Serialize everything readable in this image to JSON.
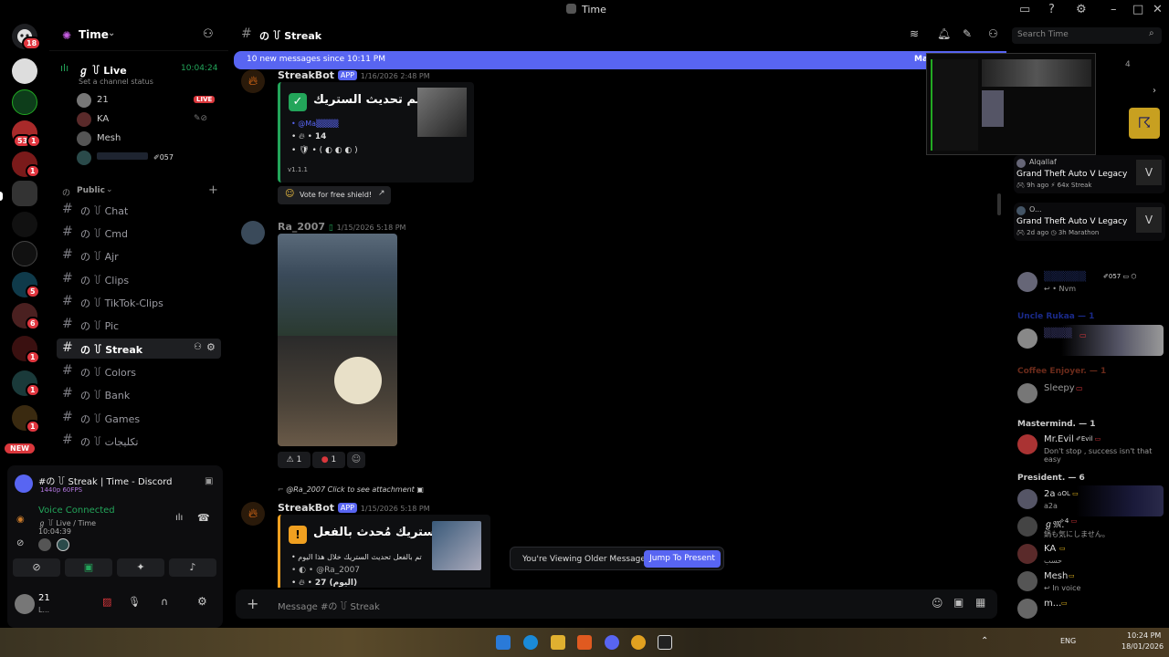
{
  "window": {
    "title": "Time"
  },
  "colors": {
    "accent": "#5865f2",
    "live": "#da373c",
    "voice_green": "#23a55a",
    "bg": "#000000",
    "new_badge": "#da373c"
  },
  "guild_badges": [
    "18",
    "53",
    "1",
    "1",
    "5",
    "1",
    "6",
    "1",
    "1",
    "1",
    "1"
  ],
  "guild_new": "NEW",
  "server": {
    "name": "Time",
    "chevron": "chevron-down-icon"
  },
  "live_channel": {
    "label": "ℊ ꒦ Live",
    "time": "10:04:24",
    "status": "Set a channel status",
    "users": [
      {
        "name": "21",
        "badge": "LIVE"
      },
      {
        "name": "KA"
      },
      {
        "name": "Mesh"
      },
      {
        "name": "",
        "tag": "057"
      }
    ]
  },
  "category": {
    "name": "Public"
  },
  "channels": [
    {
      "name": "の ꒦ Chat"
    },
    {
      "name": "の ꒦ Cmd"
    },
    {
      "name": "の ꒦ Ajr"
    },
    {
      "name": "の ꒦ Clips"
    },
    {
      "name": "の ꒦ TikTok-Clips"
    },
    {
      "name": "の ꒦ Pic"
    },
    {
      "name": "の ꒦ Streak"
    },
    {
      "name": "の ꒦ Colors"
    },
    {
      "name": "の ꒦ Bank"
    },
    {
      "name": "の ꒦ Games"
    },
    {
      "name": "の ꒦ تكليجات"
    }
  ],
  "stream_card": {
    "title": "#の ꒦ Streak | Time - Discord",
    "quality": "1440p 60FPS"
  },
  "voice": {
    "status": "Voice Connected",
    "channel": "ℊ ꒦ Live / Time",
    "timer": "10:04:39"
  },
  "user": {
    "name": "21",
    "status": "L..."
  },
  "chat": {
    "header": "の ꒦ Streak",
    "new_banner": "10 new messages since 10:11 PM",
    "new_banner_right": "Ma",
    "messages": [
      {
        "author": "StreakBot",
        "badge": "APP",
        "time": "1/16/2026 2:48 PM",
        "embed_title": "تم تحديث الستريك •",
        "mention": "@Ma▒▒▒▒",
        "streak": "14",
        "shields": "• ( ◐ ◐ ◐ )",
        "version": "v1.1.1",
        "button": "Vote for free shield!"
      },
      {
        "author": "Ra_2007",
        "time": "1/15/2026 5:18 PM",
        "reactions": [
          {
            "emoji": "⚠",
            "count": "1"
          },
          {
            "emoji": "●",
            "count": "1"
          }
        ]
      },
      {
        "reply": "@Ra_2007 Click to see attachment",
        "author": "StreakBot",
        "badge": "APP",
        "time": "1/15/2026 5:18 PM",
        "embed_title": "الستريك مُحدث بالفعل •",
        "line": "تم بالفعل تحديث الستريك خلال هذا اليوم",
        "mention": "@Ra_2007",
        "streak": "27 (اليوم)"
      }
    ],
    "older_notice": "You're Viewing Older Messages",
    "jump_button": "Jump To Present",
    "composer_placeholder": "Message #の ꒦ Streak"
  },
  "search": {
    "placeholder": "Search Time"
  },
  "activities": [
    {
      "user": "Alqallaf",
      "game": "Grand Theft Auto V Legacy",
      "ago": "9h ago",
      "stat": "64x Streak"
    },
    {
      "user": "O...",
      "game": "Grand Theft Auto V Legacy",
      "ago": "2d ago",
      "stat": "3h Marathon"
    }
  ],
  "preview_count": "4",
  "members": {
    "top": [
      {
        "name": "▒▒▒▒▒▒",
        "tag": "057",
        "status": "Nvm"
      }
    ],
    "roles": [
      {
        "role": "Uncle Rukaa — 1",
        "members": [
          {
            "name": "▒▒▒▒",
            "status": ""
          }
        ]
      },
      {
        "role": "Coffee Enjoyer. — 1",
        "members": [
          {
            "name": "Sleepy",
            "status": ""
          }
        ]
      },
      {
        "role": "Mastermind. — 1",
        "members": [
          {
            "name": "Mr.Evil",
            "tag": "Evil",
            "status": "Don't stop , success isn't that easy"
          }
        ]
      },
      {
        "role": "President. — 6",
        "members": [
          {
            "name": "2a",
            "tag": "OL",
            "status": "a2a"
          },
          {
            "name": "ℊ𝔐.",
            "tag": "4",
            "status": "鍋も気にしません。"
          },
          {
            "name": "KA",
            "status": "حسب"
          },
          {
            "name": "Mesh",
            "status": "In voice"
          },
          {
            "name": "m...",
            "status": ""
          }
        ]
      }
    ]
  },
  "tray": {
    "lang": "ENG",
    "time": "10:24 PM",
    "date": "18/01/2026"
  }
}
